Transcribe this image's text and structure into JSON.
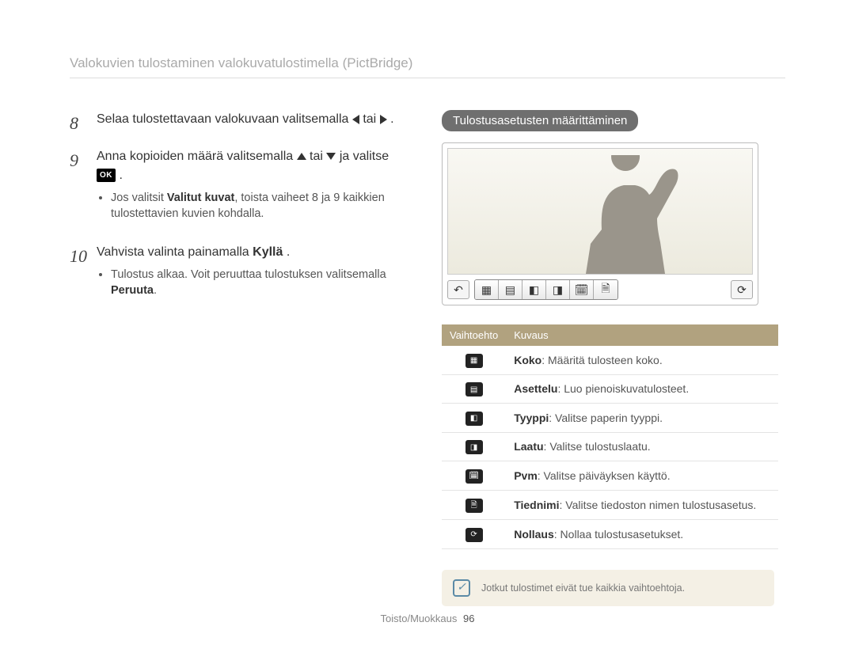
{
  "header": {
    "title": "Valokuvien tulostaminen valokuvatulostimella (PictBridge)"
  },
  "steps": {
    "s8": {
      "num": "8",
      "pre": "Selaa tulostettavaan valokuvaan valitsemalla ",
      "mid": " tai ",
      "post": " ."
    },
    "s9": {
      "num": "9",
      "pre": "Anna kopioiden määrä valitsemalla ",
      "mid": " tai ",
      "post": " ja valitse ",
      "after_ok": " .",
      "bullet_pre": "Jos valitsit ",
      "bullet_bold": "Valitut kuvat",
      "bullet_post": ", toista vaiheet 8 ja 9 kaikkien tulostettavien kuvien kohdalla."
    },
    "s10": {
      "num": "10",
      "pre": "Vahvista valinta painamalla ",
      "bold": "Kyllä",
      "post": " .",
      "bullet_pre": "Tulostus alkaa. Voit peruuttaa tulostuksen valitsemalla ",
      "bullet_bold": "Peruuta",
      "bullet_post": "."
    }
  },
  "right": {
    "pill": "Tulostusasetusten määrittäminen",
    "toolbar_icons": {
      "back": "↶",
      "size": "▦",
      "layout": "▤",
      "type": "◧",
      "quality": "◨",
      "date": "🗓",
      "file": "🗎",
      "refresh": "⟳"
    },
    "table": {
      "h1": "Vaihtoehto",
      "h2": "Kuvaus",
      "rows": [
        {
          "icon": "▦",
          "bold": "Koko",
          "rest": ": Määritä tulosteen koko."
        },
        {
          "icon": "▤",
          "bold": "Asettelu",
          "rest": ": Luo pienoiskuvatulosteet."
        },
        {
          "icon": "◧",
          "bold": "Tyyppi",
          "rest": ": Valitse paperin tyyppi."
        },
        {
          "icon": "◨",
          "bold": "Laatu",
          "rest": ": Valitse tulostuslaatu."
        },
        {
          "icon": "🗓",
          "bold": "Pvm",
          "rest": ": Valitse päiväyksen käyttö."
        },
        {
          "icon": "🗎",
          "bold": "Tiednimi",
          "rest": ": Valitse tiedoston nimen tulostusasetus."
        },
        {
          "icon": "⟳",
          "bold": "Nollaus",
          "rest": ": Nollaa tulostusasetukset."
        }
      ]
    },
    "note": "Jotkut tulostimet eivät tue kaikkia vaihtoehtoja."
  },
  "footer": {
    "section": "Toisto/Muokkaus",
    "page": "96"
  },
  "ok_label": "OK"
}
